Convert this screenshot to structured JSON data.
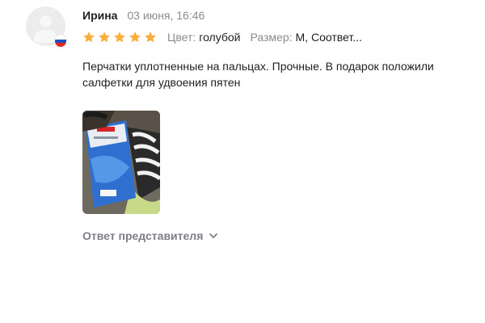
{
  "review": {
    "author": "Ирина",
    "date": "03 июня, 16:46",
    "rating": 5,
    "properties": [
      {
        "label": "Цвет:",
        "value": "голубой"
      },
      {
        "label": "Размер:",
        "value": "М, Соответ..."
      }
    ],
    "text": "Перчатки уплотненные на пальцах. Прочные. В подарок положили салфетки для удвоения пятен",
    "photo_count": 1,
    "reply_toggle_label": "Ответ представителя"
  },
  "icons": {
    "avatar": "user-silhouette-icon",
    "flag": "russia-flag-icon",
    "star": "star-icon",
    "chevron": "chevron-down-icon"
  },
  "colors": {
    "star": "#fbad3d",
    "muted_text": "#8c8c8c",
    "reply_text": "#7d7f86",
    "text": "#1f1f1f",
    "avatar_bg": "#ececec"
  }
}
